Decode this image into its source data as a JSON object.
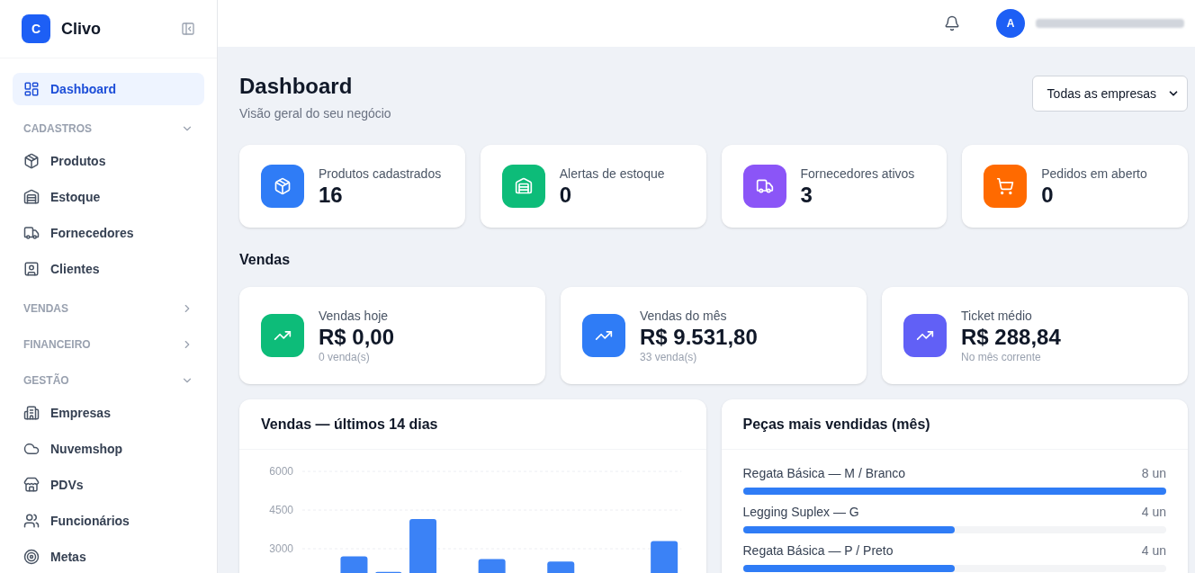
{
  "sidebar": {
    "brand": {
      "letter": "C",
      "name": "Clivo"
    },
    "items": [
      {
        "label": "Dashboard",
        "selected": true
      }
    ],
    "sections": [
      {
        "title": "CADASTROS",
        "expanded": true,
        "items": [
          {
            "label": "Produtos",
            "selected": false
          },
          {
            "label": "Estoque",
            "selected": false
          },
          {
            "label": "Fornecedores",
            "selected": false
          },
          {
            "label": "Clientes",
            "selected": false
          }
        ]
      },
      {
        "title": "VENDAS",
        "expanded": false
      },
      {
        "title": "FINANCEIRO",
        "expanded": false
      },
      {
        "title": "GESTÃO",
        "expanded": true,
        "items": [
          {
            "label": "Empresas",
            "selected": false
          },
          {
            "label": "Nuvemshop",
            "selected": false
          },
          {
            "label": "PDVs",
            "selected": false
          },
          {
            "label": "Funcionários",
            "selected": false
          },
          {
            "label": "Metas",
            "selected": false
          }
        ]
      }
    ]
  },
  "header": {
    "avatar": "A"
  },
  "page": {
    "title": "Dashboard",
    "subtitle": "Visão geral do seu negócio",
    "company_select": {
      "value": "Todas as empresas"
    }
  },
  "stats": [
    {
      "label": "Produtos cadastrados",
      "value": "16",
      "color": "#2f7cf6"
    },
    {
      "label": "Alertas de estoque",
      "value": "0",
      "color": "#0dbc79"
    },
    {
      "label": "Fornecedores ativos",
      "value": "3",
      "color": "#8b55f7"
    },
    {
      "label": "Pedidos em aberto",
      "value": "0",
      "color": "#ff6a00"
    }
  ],
  "sales_heading": "Vendas",
  "sales": [
    {
      "label": "Vendas hoje",
      "value": "R$ 0,00",
      "note": "0 venda(s)",
      "color": "#0dbc79"
    },
    {
      "label": "Vendas do mês",
      "value": "R$ 9.531,80",
      "note": "33 venda(s)",
      "color": "#2f7cf6"
    },
    {
      "label": "Ticket médio",
      "value": "R$ 288,84",
      "note": "No mês corrente",
      "color": "#6160f6"
    }
  ],
  "chart_card": {
    "title": "Vendas — últimos 14 dias",
    "chart_data": {
      "type": "bar",
      "ylim": [
        0,
        6000
      ],
      "yticks": [
        3000,
        4500,
        6000
      ],
      "values": [
        null,
        2700,
        2100,
        4150,
        null,
        2600,
        null,
        2500,
        null,
        null,
        3300
      ]
    }
  },
  "top_products": {
    "title": "Peças mais vendidas (mês)",
    "items": [
      {
        "name": "Regata Básica — M / Branco",
        "qty": "8 un",
        "level": 1
      },
      {
        "name": "Legging Suplex — G",
        "qty": "4 un",
        "level": 0.5
      },
      {
        "name": "Regata Básica — P / Preto",
        "qty": "4 un",
        "level": 0.5
      }
    ]
  }
}
